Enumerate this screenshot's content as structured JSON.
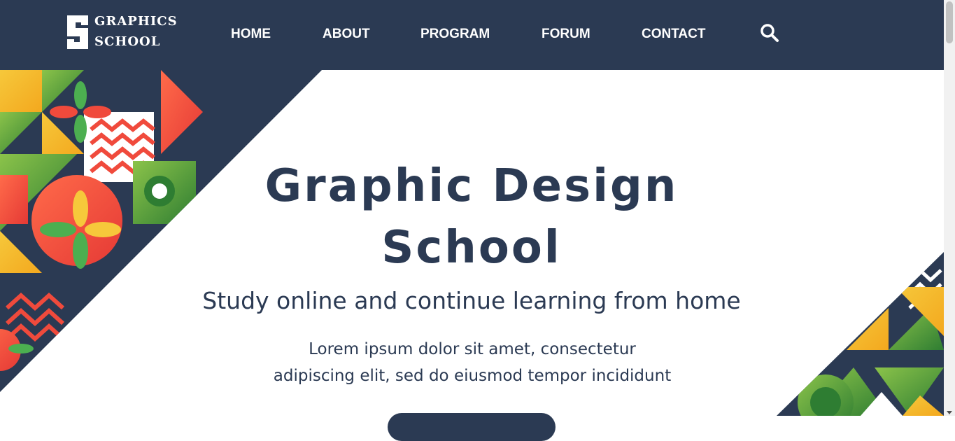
{
  "brand": {
    "logo_letter": "S",
    "line1": "GRAPHICS",
    "line2": "SCHOOL"
  },
  "nav": {
    "items": [
      {
        "label": "HOME"
      },
      {
        "label": "ABOUT"
      },
      {
        "label": "PROGRAM"
      },
      {
        "label": "FORUM"
      },
      {
        "label": "CONTACT"
      }
    ],
    "search_icon": "search-icon"
  },
  "hero": {
    "title_line1": "Graphic Design",
    "title_line2": "School",
    "subtitle": "Study online and continue learning from home",
    "text_line1": "Lorem ipsum dolor sit amet, consectetur",
    "text_line2": "adipiscing elit, sed do eiusmod tempor incididunt"
  },
  "colors": {
    "navy": "#2b3a53",
    "red": "#f04a3c",
    "yellow": "#f6c83b",
    "green": "#4caf50",
    "white": "#ffffff"
  }
}
